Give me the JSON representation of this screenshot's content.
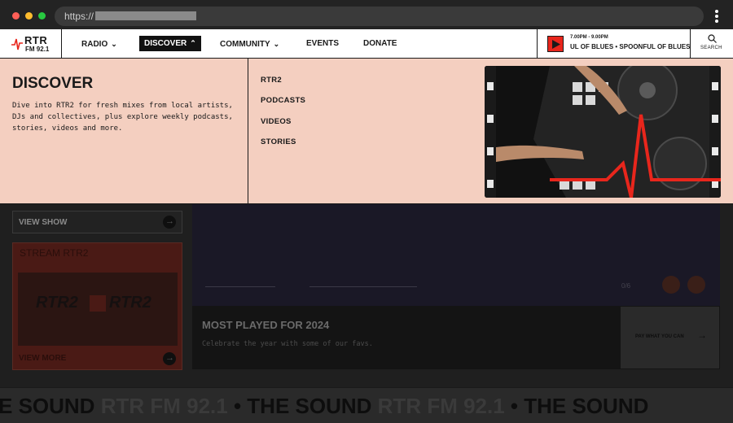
{
  "browser": {
    "url_prefix": "https://"
  },
  "nav": {
    "logo_text": "RTR",
    "logo_freq": "FM 92.1",
    "items": [
      {
        "label": "RADIO",
        "chevron": "chevron-down"
      },
      {
        "label": "DISCOVER",
        "chevron": "chevron-up",
        "active": true
      },
      {
        "label": "COMMUNITY",
        "chevron": "chevron-down"
      },
      {
        "label": "EVENTS"
      },
      {
        "label": "DONATE"
      }
    ],
    "now_playing": {
      "time": "7.00PM - 9.00PM",
      "show": "UL OF BLUES  • SPOONFUL OF BLUES"
    },
    "search_label": "SEARCH"
  },
  "dropdown": {
    "title": "DISCOVER",
    "description": "Dive into RTR2 for fresh mixes from local artists, DJs and collectives, plus explore weekly podcasts, stories, videos and more.",
    "links": [
      "RTR2",
      "PODCASTS",
      "VIDEOS",
      "STORIES"
    ],
    "image_icon": "dj-turntable-image"
  },
  "background": {
    "view_show": "VIEW SHOW",
    "stream_title": "STREAM RTR2",
    "stream_card_text": "RTR2",
    "view_more": "VIEW MORE",
    "counter": "0/6",
    "most_played_title": "MOST PLAYED FOR 2024",
    "most_played_desc": "Celebrate the year with some of our favs.",
    "pay_label": "PAY WHAT YOU CAN",
    "marquee": {
      "word_a": "E SOUND",
      "word_b": "• THE SOUND",
      "word_c": "• THE SOUND",
      "ghost": "RTR FM 92.1"
    }
  },
  "colors": {
    "accent_red": "#e8261c",
    "dropdown_bg": "#f4cfc0",
    "nav_active_bg": "#111111"
  }
}
